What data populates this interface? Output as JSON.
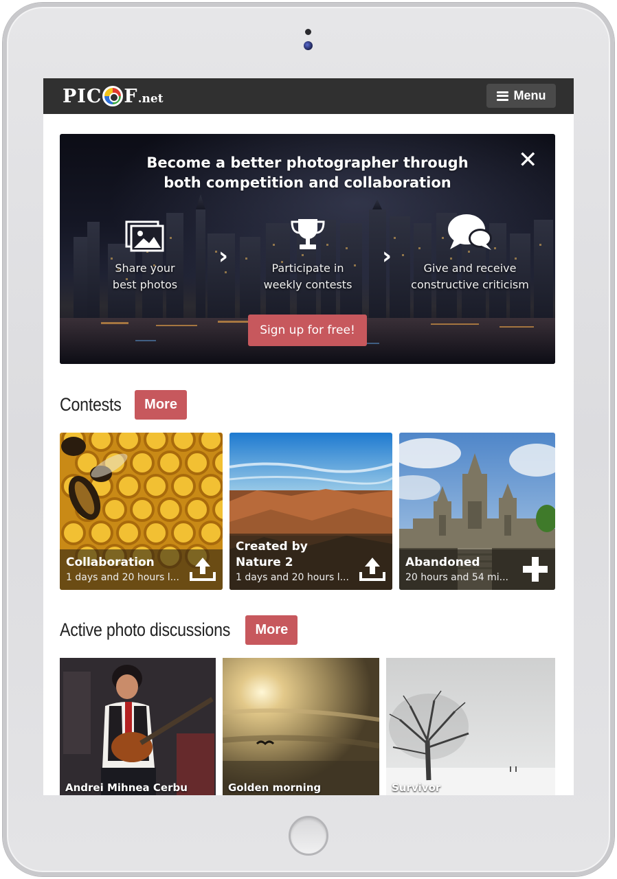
{
  "header": {
    "logo_text_left": "PIC",
    "logo_text_right": "F",
    "logo_suffix": ".net",
    "menu_label": "Menu"
  },
  "hero": {
    "title_line1": "Become a better photographer through",
    "title_line2": "both competition and collaboration",
    "close_icon": "close-icon",
    "steps": [
      {
        "icon": "photos-icon",
        "line1": "Share your",
        "line2": "best photos"
      },
      {
        "icon": "trophy-icon",
        "line1": "Participate in",
        "line2": "weekly contests"
      },
      {
        "icon": "chat-bubbles-icon",
        "line1": "Give and receive",
        "line2": "constructive criticism"
      }
    ],
    "signup_label": "Sign up for free!"
  },
  "contests": {
    "title": "Contests",
    "more_label": "More",
    "items": [
      {
        "name_line1": "Collaboration",
        "name_line2": "",
        "time": "1 days and 20 hours l...",
        "action_icon": "upload-icon"
      },
      {
        "name_line1": "Created by",
        "name_line2": "Nature 2",
        "time": "1 days and 20 hours l...",
        "action_icon": "upload-icon"
      },
      {
        "name_line1": "Abandoned",
        "name_line2": "",
        "time": "20 hours and 54 mi...",
        "action_icon": "plus-icon"
      }
    ]
  },
  "discussions": {
    "title": "Active photo discussions",
    "more_label": "More",
    "items": [
      {
        "label": "Andrei Mihnea Cerbu"
      },
      {
        "label": "Golden morning"
      },
      {
        "label": "Survivor"
      }
    ]
  },
  "colors": {
    "accent": "#c7585d",
    "topbar": "#303030",
    "menu_button": "#4a4a4a"
  }
}
